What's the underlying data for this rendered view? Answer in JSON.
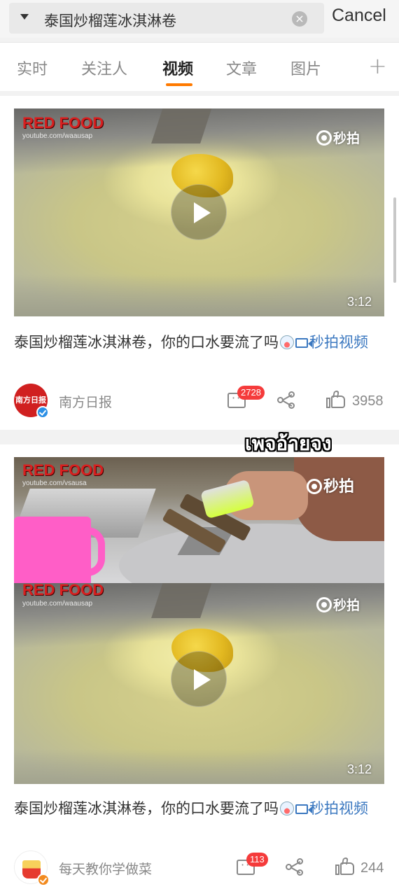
{
  "search": {
    "query": "泰国炒榴莲冰淇淋卷",
    "clear_symbol": "×",
    "cancel_label": "Cancel"
  },
  "tabs": [
    {
      "label": "实时",
      "active": false
    },
    {
      "label": "关注人",
      "active": false
    },
    {
      "label": "视频",
      "active": true
    },
    {
      "label": "文章",
      "active": false
    },
    {
      "label": "图片",
      "active": false
    }
  ],
  "tab_add_symbol": "+",
  "accent_color": "#ff7a00",
  "overlay_text": "เพจอ้ายจง",
  "posts": [
    {
      "watermark": "RED FOOD",
      "watermark_url": "youtube.com/waausap",
      "platform_watermark": "秒拍",
      "duration": "3:12",
      "caption_text": "泰国炒榴莲冰淇淋卷，你的口水要流了吗",
      "caption_link": "秒拍视频",
      "author": "南方日报",
      "avatar_text": "南方日报",
      "comments_badge": "2728",
      "likes": "3958"
    },
    {
      "watermark": "RED FOOD",
      "watermark_url": "youtube.com/waausap",
      "watermark_top": "RED FOOD",
      "watermark_top_url": "youtube.com/vsausa",
      "platform_watermark": "秒拍",
      "platform_watermark_top": "秒拍",
      "duration": "3:12",
      "caption_text": "泰国炒榴莲冰淇淋卷，你的口水要流了吗",
      "caption_link": "秒拍视频",
      "author": "每天教你学做菜",
      "comments_badge": "113",
      "likes": "244"
    }
  ]
}
